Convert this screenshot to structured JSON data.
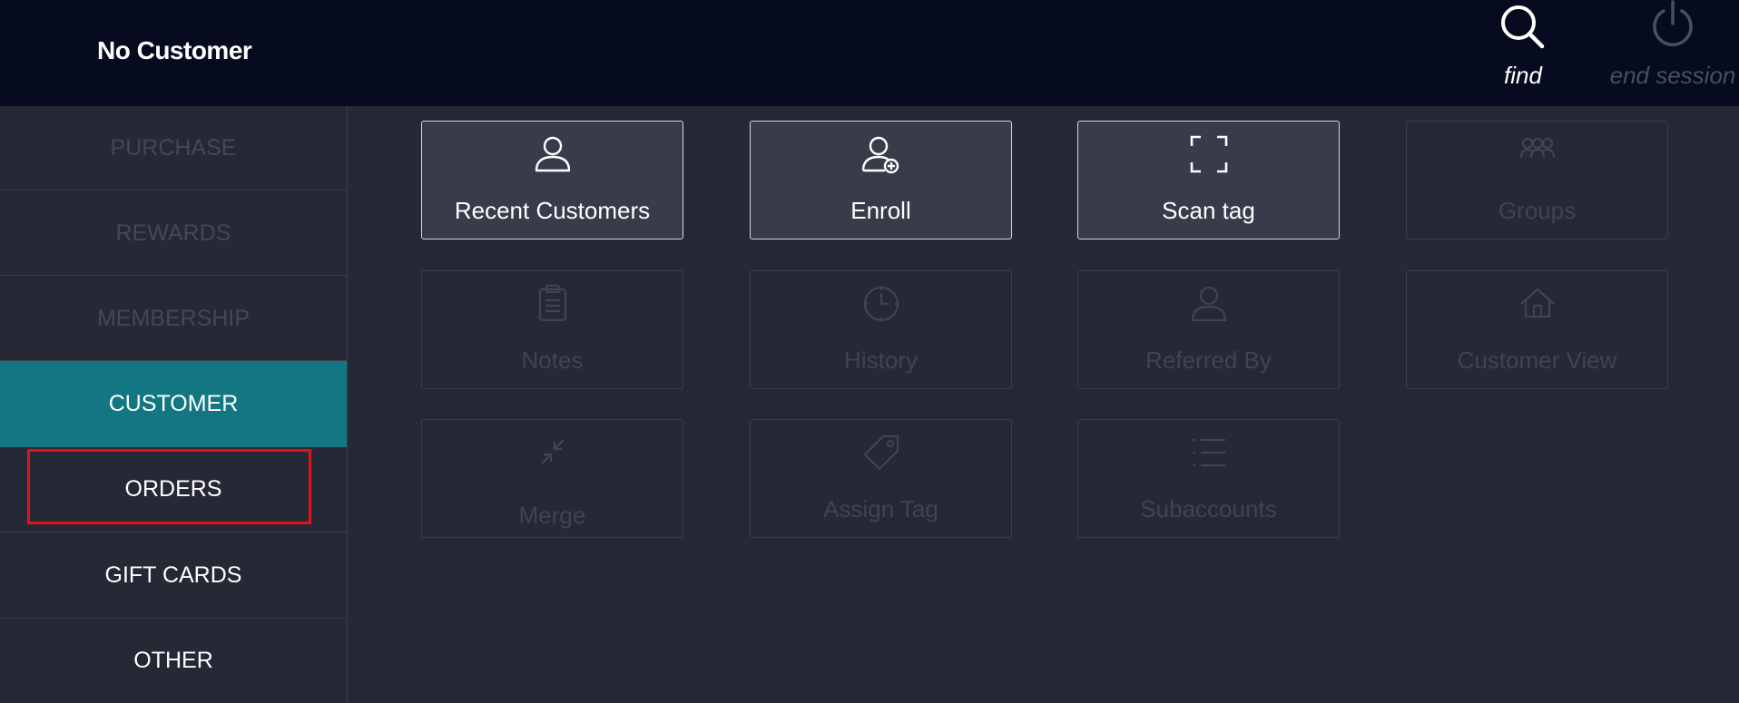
{
  "header": {
    "customer_name": "No Customer",
    "find_label": "find",
    "end_session_label": "end session"
  },
  "sidebar": {
    "items": [
      {
        "label": "PURCHASE",
        "state": "disabled"
      },
      {
        "label": "REWARDS",
        "state": "disabled"
      },
      {
        "label": "MEMBERSHIP",
        "state": "disabled"
      },
      {
        "label": "CUSTOMER",
        "state": "active"
      },
      {
        "label": "ORDERS",
        "state": "enabled"
      },
      {
        "label": "GIFT CARDS",
        "state": "enabled"
      },
      {
        "label": "OTHER",
        "state": "enabled"
      }
    ]
  },
  "tiles": [
    {
      "label": "Recent Customers",
      "icon": "person-icon",
      "enabled": true
    },
    {
      "label": "Enroll",
      "icon": "person-add-icon",
      "enabled": true
    },
    {
      "label": "Scan tag",
      "icon": "scan-frame-icon",
      "enabled": true
    },
    {
      "label": "Groups",
      "icon": "group-icon",
      "enabled": false
    },
    {
      "label": "Notes",
      "icon": "clipboard-icon",
      "enabled": false
    },
    {
      "label": "History",
      "icon": "clock-icon",
      "enabled": false
    },
    {
      "label": "Referred By",
      "icon": "person-icon",
      "enabled": false
    },
    {
      "label": "Customer View",
      "icon": "house-icon",
      "enabled": false
    },
    {
      "label": "Merge",
      "icon": "merge-arrows-icon",
      "enabled": false
    },
    {
      "label": "Assign Tag",
      "icon": "tag-icon",
      "enabled": false
    },
    {
      "label": "Subaccounts",
      "icon": "list-icon",
      "enabled": false
    }
  ],
  "colors": {
    "header_bg": "#060b1f",
    "page_bg": "#262835",
    "active_nav": "#127783",
    "enabled_tile_bg": "#383b4a",
    "highlight": "#e01414"
  }
}
